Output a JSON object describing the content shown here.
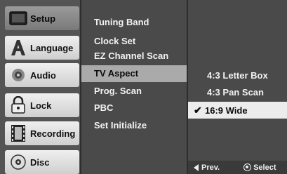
{
  "categories": [
    {
      "label": "Setup",
      "icon": "tv-icon",
      "selected": true
    },
    {
      "label": "Language",
      "icon": "language-a-icon",
      "selected": false
    },
    {
      "label": "Audio",
      "icon": "audio-icon",
      "selected": false
    },
    {
      "label": "Lock",
      "icon": "padlock-icon",
      "selected": false
    },
    {
      "label": "Recording",
      "icon": "film-strip-icon",
      "selected": false
    },
    {
      "label": "Disc",
      "icon": "disc-icon",
      "selected": false
    }
  ],
  "menu": {
    "items": [
      {
        "label": "Tuning Band"
      },
      {
        "label": "Clock Set"
      },
      {
        "label": "EZ Channel Scan"
      },
      {
        "label": "TV Aspect",
        "active": true
      },
      {
        "label": "Prog. Scan"
      },
      {
        "label": "PBC"
      },
      {
        "label": "Set Initialize"
      }
    ]
  },
  "options": {
    "items": [
      {
        "label": "4:3 Letter Box"
      },
      {
        "label": "4:3 Pan Scan"
      },
      {
        "label": "16:9 Wide",
        "checked": true
      }
    ],
    "check_mark": "✔"
  },
  "footer": {
    "prev_label": "Prev.",
    "select_label": "Select"
  }
}
